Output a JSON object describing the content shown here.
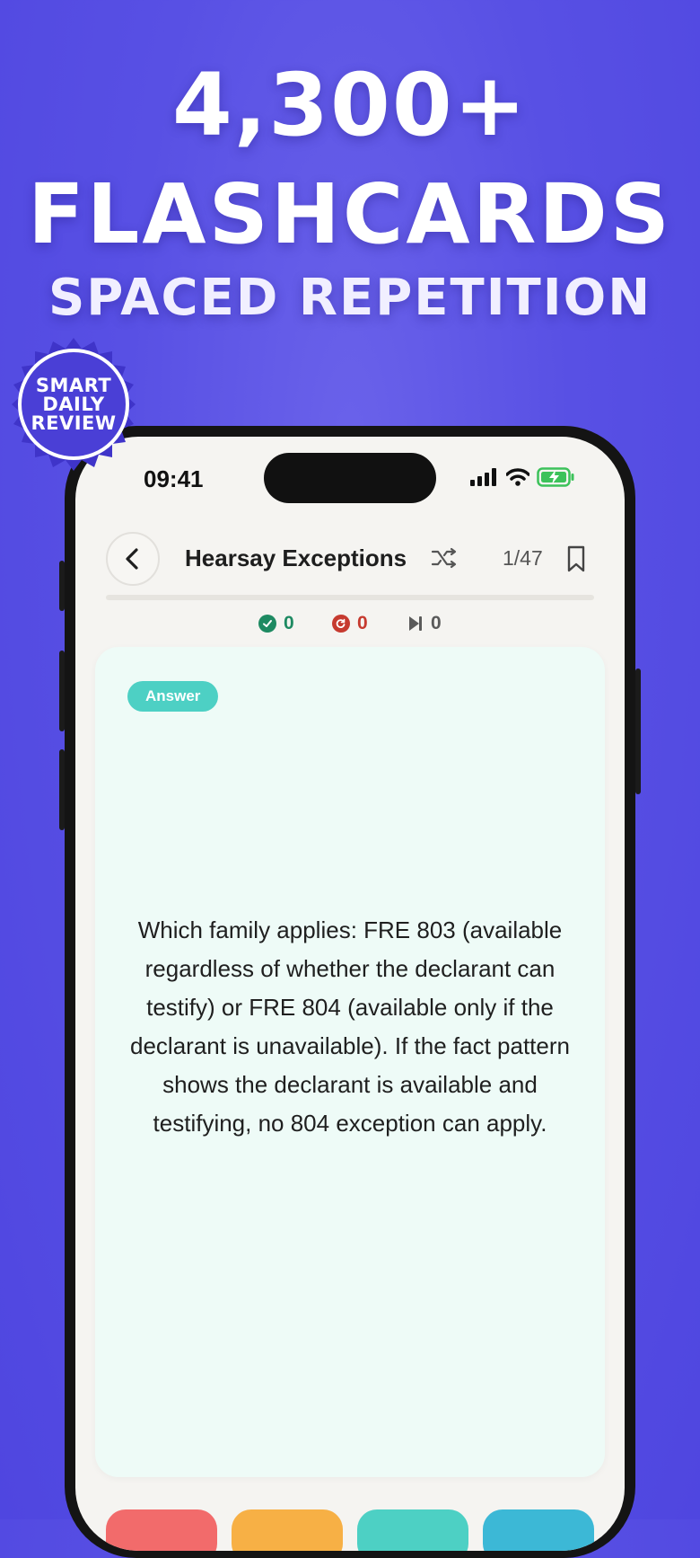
{
  "hero": {
    "line1": "4,300+",
    "line2": "FLASHCARDS",
    "line3": "SPACED REPETITION"
  },
  "badge": {
    "lines": [
      "SMART",
      "DAILY",
      "REVIEW"
    ]
  },
  "status_bar": {
    "time": "09:41"
  },
  "nav": {
    "title": "Hearsay Exceptions",
    "counter": "1/47"
  },
  "stats": {
    "correct": "0",
    "retry": "0",
    "skipped": "0"
  },
  "card": {
    "tag": "Answer",
    "text": "Which family applies: FRE 803 (available regardless of whether the declarant can testify) or FRE 804 (available only if the declarant is unavailable). If the fact pattern shows the declarant is available and testifying, no 804 exception can apply."
  },
  "colors": {
    "background": "#5850e4",
    "card": "#eefbf7",
    "tag": "#4dd0c4",
    "correct": "#1e8a62",
    "retry": "#c63a2f",
    "skipped": "#5a5a5a",
    "buttons": [
      "#f26b6b",
      "#f7b045",
      "#4dd0c4",
      "#3cb8d6"
    ]
  },
  "icons": [
    "back-chevron-icon",
    "shuffle-icon",
    "bookmark-icon",
    "check-circle-icon",
    "retry-circle-icon",
    "skip-icon",
    "signal-icon",
    "wifi-icon",
    "battery-icon"
  ]
}
